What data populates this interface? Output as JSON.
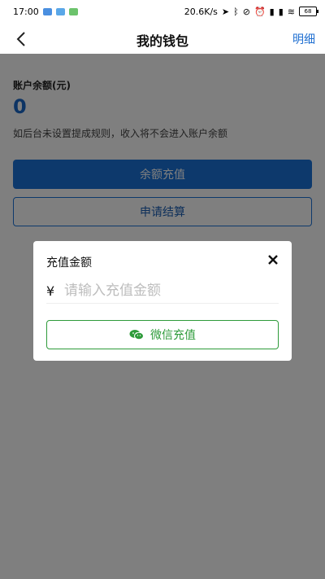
{
  "status_bar": {
    "time": "17:00",
    "network_speed": "20.6K/s",
    "battery": "68"
  },
  "nav": {
    "title": "我的钱包",
    "detail_label": "明细"
  },
  "balance": {
    "label": "账户余额(元)",
    "value": "0"
  },
  "hint": "如后台未设置提成规则，收入将不会进入账户余额",
  "buttons": {
    "recharge_label": "余额充值",
    "settle_label": "申请结算"
  },
  "dialog": {
    "title": "充值金额",
    "currency_symbol": "¥",
    "amount_placeholder": "请输入充值金额",
    "amount_value": "",
    "wechat_label": "微信充值"
  },
  "colors": {
    "accent": "#1a73d8",
    "wechat_green": "#2e9b3a",
    "overlay": "rgba(0,0,0,0.5)"
  }
}
